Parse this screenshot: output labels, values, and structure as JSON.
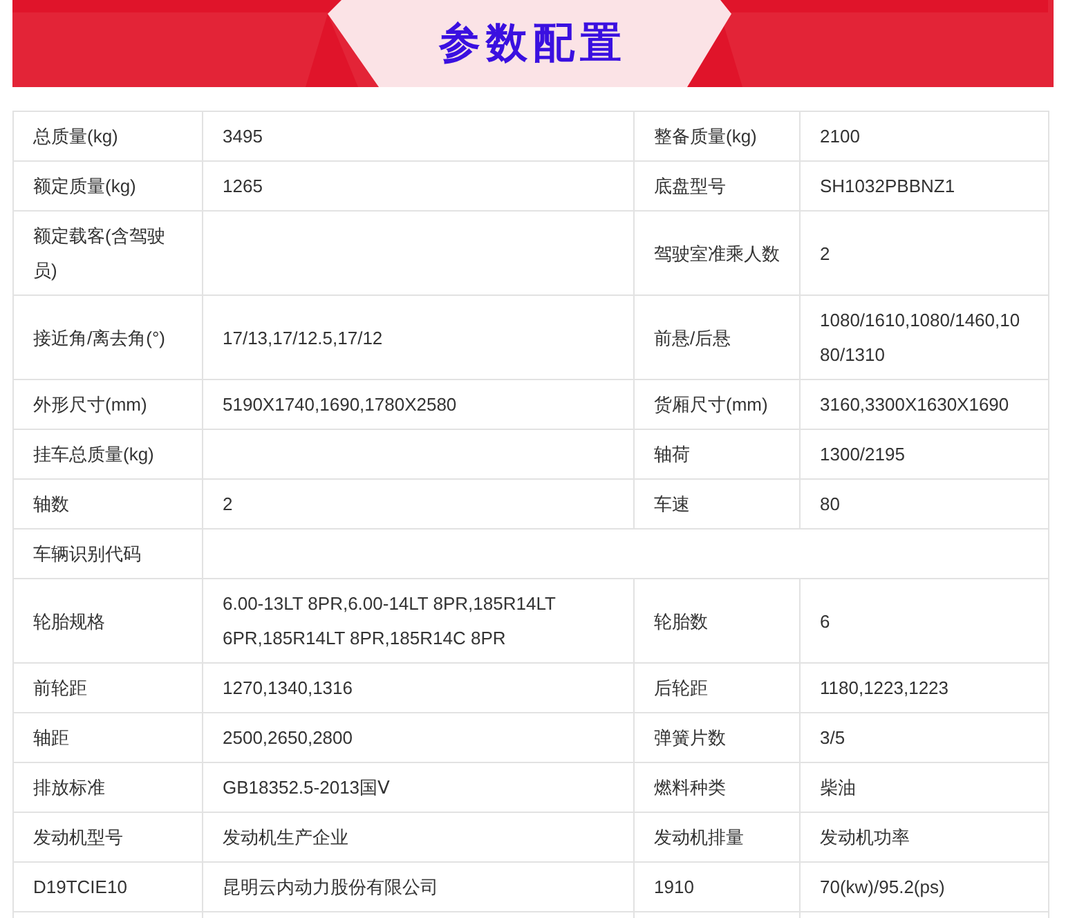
{
  "banner": {
    "title": "参数配置"
  },
  "rows": [
    {
      "pairs": [
        {
          "label": "总质量(kg)",
          "value": "3495"
        },
        {
          "label": "整备质量(kg)",
          "value": "2100"
        }
      ]
    },
    {
      "pairs": [
        {
          "label": "额定质量(kg)",
          "value": "1265"
        },
        {
          "label": "底盘型号",
          "value": "SH1032PBBNZ1"
        }
      ]
    },
    {
      "pairs": [
        {
          "label": "额定载客(含驾驶员)"
        },
        {
          "label": "驾驶室准乘人数",
          "value": "2"
        }
      ]
    },
    {
      "pairs": [
        {
          "label": "接近角/离去角(°)",
          "value": "17/13,17/12.5,17/12"
        },
        {
          "label": "前悬/后悬",
          "value": "1080/1610,1080/1460,1080/1310"
        }
      ]
    },
    {
      "pairs": [
        {
          "label": "外形尺寸(mm)",
          "value": "5190X1740,1690,1780X2580"
        },
        {
          "label": "货厢尺寸(mm)",
          "value": "3160,3300X1630X1690"
        }
      ]
    },
    {
      "pairs": [
        {
          "label": "挂车总质量(kg)"
        },
        {
          "label": "轴荷",
          "value": "1300/2195"
        }
      ]
    },
    {
      "pairs": [
        {
          "label": "轴数",
          "value": "2"
        },
        {
          "label": "车速",
          "value": "80"
        }
      ]
    },
    {
      "pairs": [
        {
          "label": "车辆识别代码"
        }
      ]
    },
    {
      "pairs": [
        {
          "label": "轮胎规格",
          "value": "6.00-13LT 8PR,6.00-14LT 8PR,185R14LT 6PR,185R14LT 8PR,185R14C 8PR"
        },
        {
          "label": "轮胎数",
          "value": "6"
        }
      ]
    },
    {
      "pairs": [
        {
          "label": "前轮距",
          "value": "1270,1340,1316"
        },
        {
          "label": "后轮距",
          "value": "1180,1223,1223"
        }
      ]
    },
    {
      "pairs": [
        {
          "label": "轴距",
          "value": "2500,2650,2800"
        },
        {
          "label": "弹簧片数",
          "value": "3/5"
        }
      ]
    },
    {
      "pairs": [
        {
          "label": "排放标准",
          "value": "GB18352.5-2013国Ⅴ"
        },
        {
          "label": "燃料种类",
          "value": "柴油"
        }
      ]
    },
    {
      "pairs": [
        {
          "label": "发动机型号",
          "value": "发动机生产企业"
        },
        {
          "label": "发动机排量",
          "value": "发动机功率"
        }
      ]
    },
    {
      "pairs": [
        {
          "label": "D19TCIE10",
          "value": "昆明云内动力股份有限公司"
        },
        {
          "label": "1910",
          "value": "70(kw)/95.2(ps)"
        }
      ]
    }
  ]
}
